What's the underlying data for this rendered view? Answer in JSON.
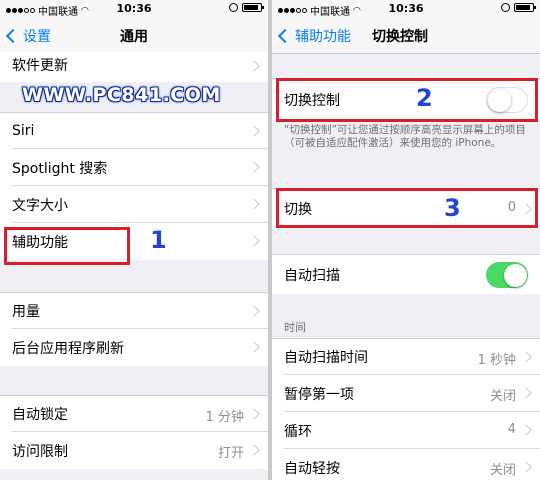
{
  "left": {
    "status": {
      "carrier": "中国联通",
      "time": "10:36"
    },
    "nav": {
      "back_label": "设置",
      "title": "通用"
    },
    "rows": {
      "software_update": "软件更新",
      "siri": "Siri",
      "spotlight": "Spotlight 搜索",
      "text_size": "文字大小",
      "accessibility": "辅助功能",
      "usage": "用量",
      "background_refresh": "后台应用程序刷新",
      "auto_lock": {
        "label": "自动锁定",
        "value": "1 分钟"
      },
      "restrictions": {
        "label": "访问限制",
        "value": "打开"
      }
    },
    "watermark": "WWW.PC841.COM",
    "annotation": "1"
  },
  "right": {
    "status": {
      "carrier": "中国联通",
      "time": "10:36"
    },
    "nav": {
      "back_label": "辅助功能",
      "title": "切换控制"
    },
    "switch_control": {
      "label": "切换控制",
      "on": false
    },
    "description": "“切换控制”可让您通过按顺序高亮显示屏幕上的项目（可被自适应配件激活）来使用您的 iPhone。",
    "switches": {
      "label": "切换",
      "value": "0"
    },
    "auto_scan": {
      "label": "自动扫描",
      "on": true
    },
    "timing_header": "时间",
    "auto_scan_time": {
      "label": "自动扫描时间",
      "value": "1 秒钟"
    },
    "pause_first": {
      "label": "暂停第一项",
      "value": "关闭"
    },
    "loops": {
      "label": "循环",
      "value": "4"
    },
    "auto_tap": {
      "label": "自动轻按",
      "value": "关闭"
    },
    "annotations": [
      "2",
      "3"
    ]
  },
  "colors": {
    "accent": "#0b7cf6",
    "toggle_on": "#4cd964",
    "highlight": "#d81e2a",
    "annotation": "#2046d8"
  }
}
